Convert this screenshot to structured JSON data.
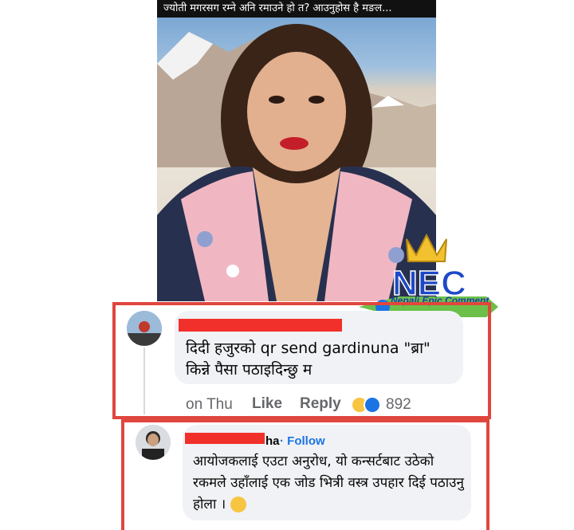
{
  "video": {
    "title": "ज्योती मगरसग रम्ने अनि रमाउने हो त? आउनुहोस है मङल..."
  },
  "watermark": {
    "logo_text": "NEC",
    "label": "Nepali Epic Comment"
  },
  "comments": [
    {
      "text": "दिदी हजुरको qr send gardinuna \"ब्रा\" किन्ने पैसा पठाइदिन्छु म",
      "time": "on Thu",
      "like_label": "Like",
      "reply_label": "Reply",
      "reactions": [
        "haha-icon",
        "like-icon"
      ],
      "reaction_count": "892"
    },
    {
      "name_suffix": "ha",
      "follow_label": "· Follow",
      "text": "आयोजकलाई एउटा अनुरोध, यो कन्सर्टबाट उठेको रकमले उहाँलाई एक जोड भित्री वस्त्र उपहार दिई पठाउनु होला ।"
    }
  ],
  "colors": {
    "highlight": "#e0463e",
    "redaction": "#f2302b",
    "bubble": "#f0f2f5",
    "link": "#1b74e4"
  }
}
